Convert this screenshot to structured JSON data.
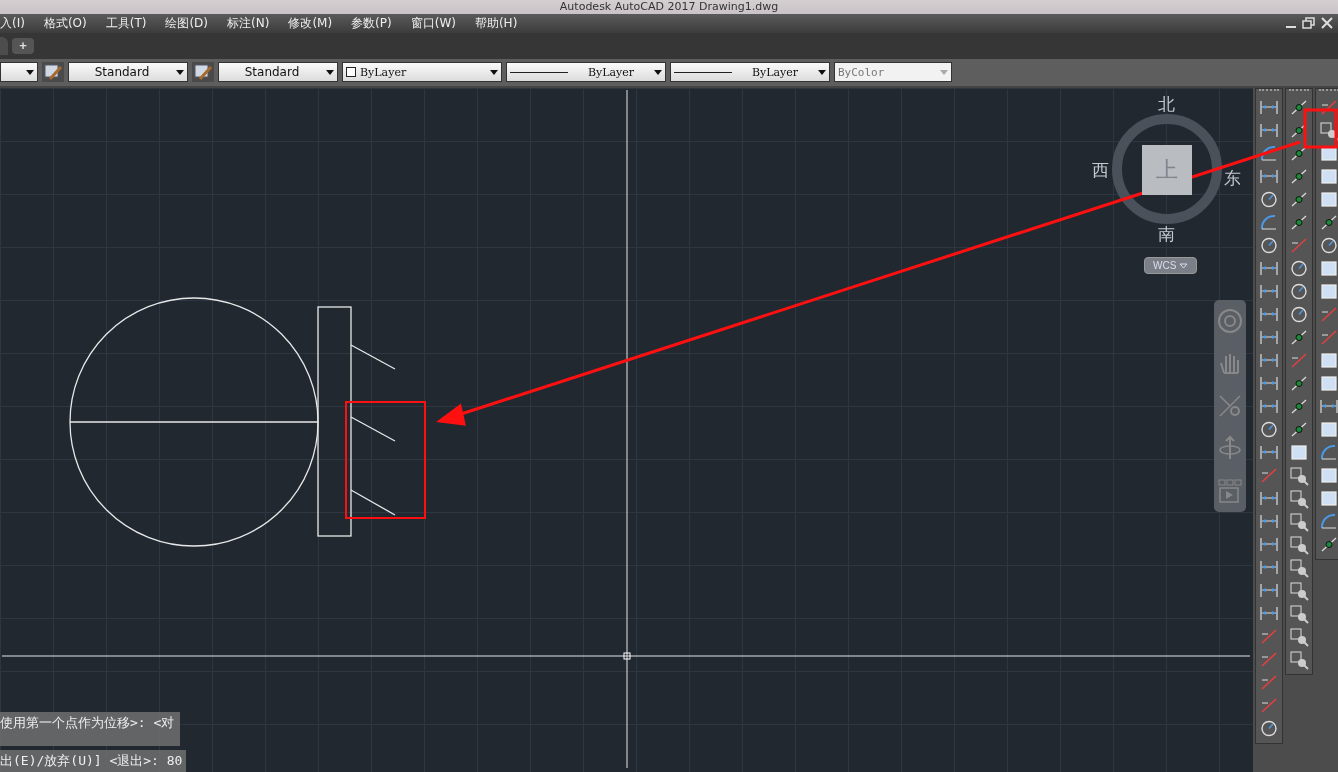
{
  "title_bar": {
    "title": "Autodesk AutoCAD 2017    Drawing1.dwg"
  },
  "menu_bar": {
    "items": [
      "入(I)",
      "格式(O)",
      "工具(T)",
      "绘图(D)",
      "标注(N)",
      "修改(M)",
      "参数(P)",
      "窗口(W)",
      "帮助(H)"
    ]
  },
  "file_tabs": {
    "add_label": "+"
  },
  "toolbar": {
    "dropdowns": [
      {
        "kind": "plain",
        "disabled": false
      },
      {
        "kind": "style",
        "value": "Standard",
        "disabled": false
      },
      {
        "kind": "style",
        "value": "Standard",
        "disabled": false
      },
      {
        "kind": "color",
        "value": "ByLayer",
        "disabled": false
      },
      {
        "kind": "line",
        "value": "ByLayer",
        "disabled": false
      },
      {
        "kind": "line",
        "value": "ByLayer",
        "disabled": false
      },
      {
        "kind": "plain",
        "value": "ByColor",
        "disabled": true
      }
    ]
  },
  "viewcube": {
    "north": "北",
    "south": "南",
    "west": "西",
    "east": "东",
    "face": "上",
    "ucs": "WCS"
  },
  "command_line": {
    "lines": [
      "使用第一个点作为位移>:  <对",
      "出(E)/放弃(U)] <退出>: 80"
    ]
  }
}
